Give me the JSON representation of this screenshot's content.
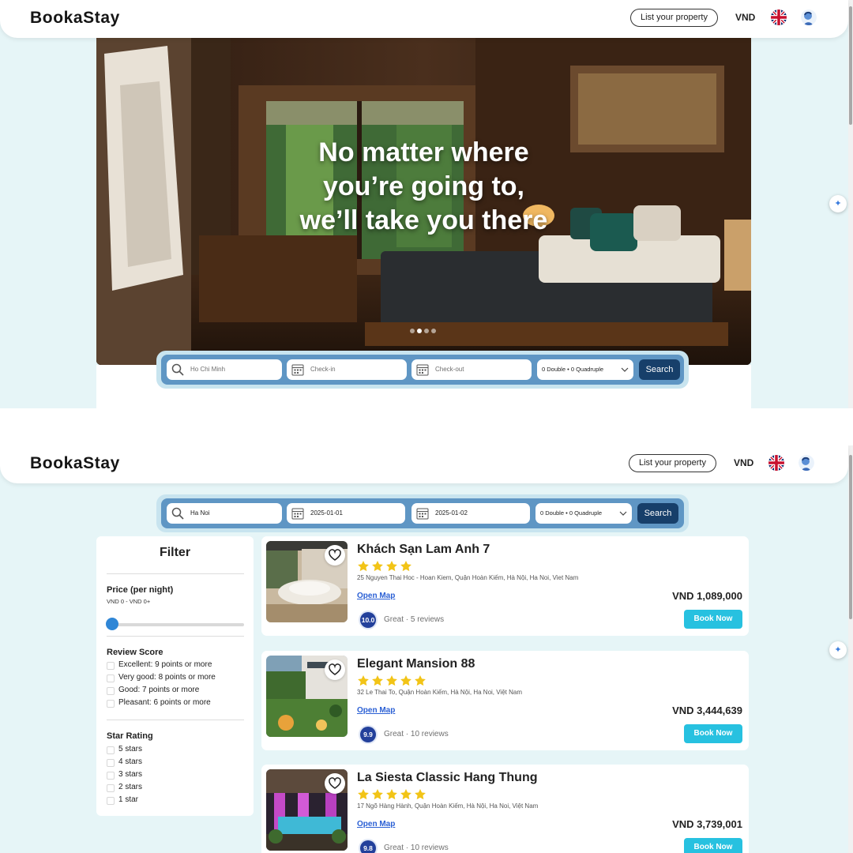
{
  "header": {
    "logo": "BookaStay",
    "list_property": "List your property",
    "currency": "VND"
  },
  "hero": {
    "title": "No matter where you’re going to, we’ll take you there",
    "slide_count": 4,
    "active_slide": 3
  },
  "search_home": {
    "destination_placeholder": "Ho Chi Minh",
    "checkin_placeholder": "Check-in",
    "checkout_placeholder": "Check-out",
    "guests": "0 Double  •  0 Quadruple",
    "button": "Search"
  },
  "search_results": {
    "destination": "Ha Noi",
    "checkin": "2025-01-01",
    "checkout": "2025-01-02",
    "guests": "0 Double  •  0 Quadruple",
    "button": "Search"
  },
  "filter": {
    "title": "Filter",
    "price_label": "Price (per night)",
    "price_range": "VND 0 - VND 0+",
    "slider_value": 0,
    "review_label": "Review Score",
    "review_options": [
      "Excellent: 9 points or more",
      "Very good: 8 points or more",
      "Good: 7 points or more",
      "Pleasant: 6 points or more"
    ],
    "star_label": "Star Rating",
    "star_options": [
      "5 stars",
      "4 stars",
      "3 stars",
      "2 stars",
      "1 star"
    ]
  },
  "hotels": [
    {
      "name": "Khách Sạn Lam Anh 7",
      "stars": 4,
      "address": "25 Nguyen Thai Hoc - Hoan Kiem, Quận Hoàn Kiếm, Hà Nội, Ha Noi, Viet Nam",
      "map_link": "Open Map",
      "score": "10.0",
      "rating": "Great · 5 reviews",
      "price": "VND 1,089,000",
      "book": "Book Now"
    },
    {
      "name": "Elegant Mansion 88",
      "stars": 5,
      "address": "32 Le Thai To, Quận Hoàn Kiếm, Hà Nội, Ha Noi, Việt Nam",
      "map_link": "Open Map",
      "score": "9.9",
      "rating": "Great · 10 reviews",
      "price": "VND 3,444,639",
      "book": "Book Now"
    },
    {
      "name": "La Siesta Classic Hang Thung",
      "stars": 5,
      "address": "17 Ngõ Hàng Hành, Quận Hoàn Kiếm, Hà Nội, Ha Noi, Việt Nam",
      "map_link": "Open Map",
      "score": "9.8",
      "rating": "Great · 10 reviews",
      "price": "VND 3,739,001",
      "book": "Book Now"
    }
  ],
  "colors": {
    "accent": "#27c1e0",
    "search_bar": "#5f96c4",
    "search_button": "#173f6a",
    "score_badge": "#23409b",
    "star": "#f2c417",
    "link": "#2a5fd4"
  }
}
